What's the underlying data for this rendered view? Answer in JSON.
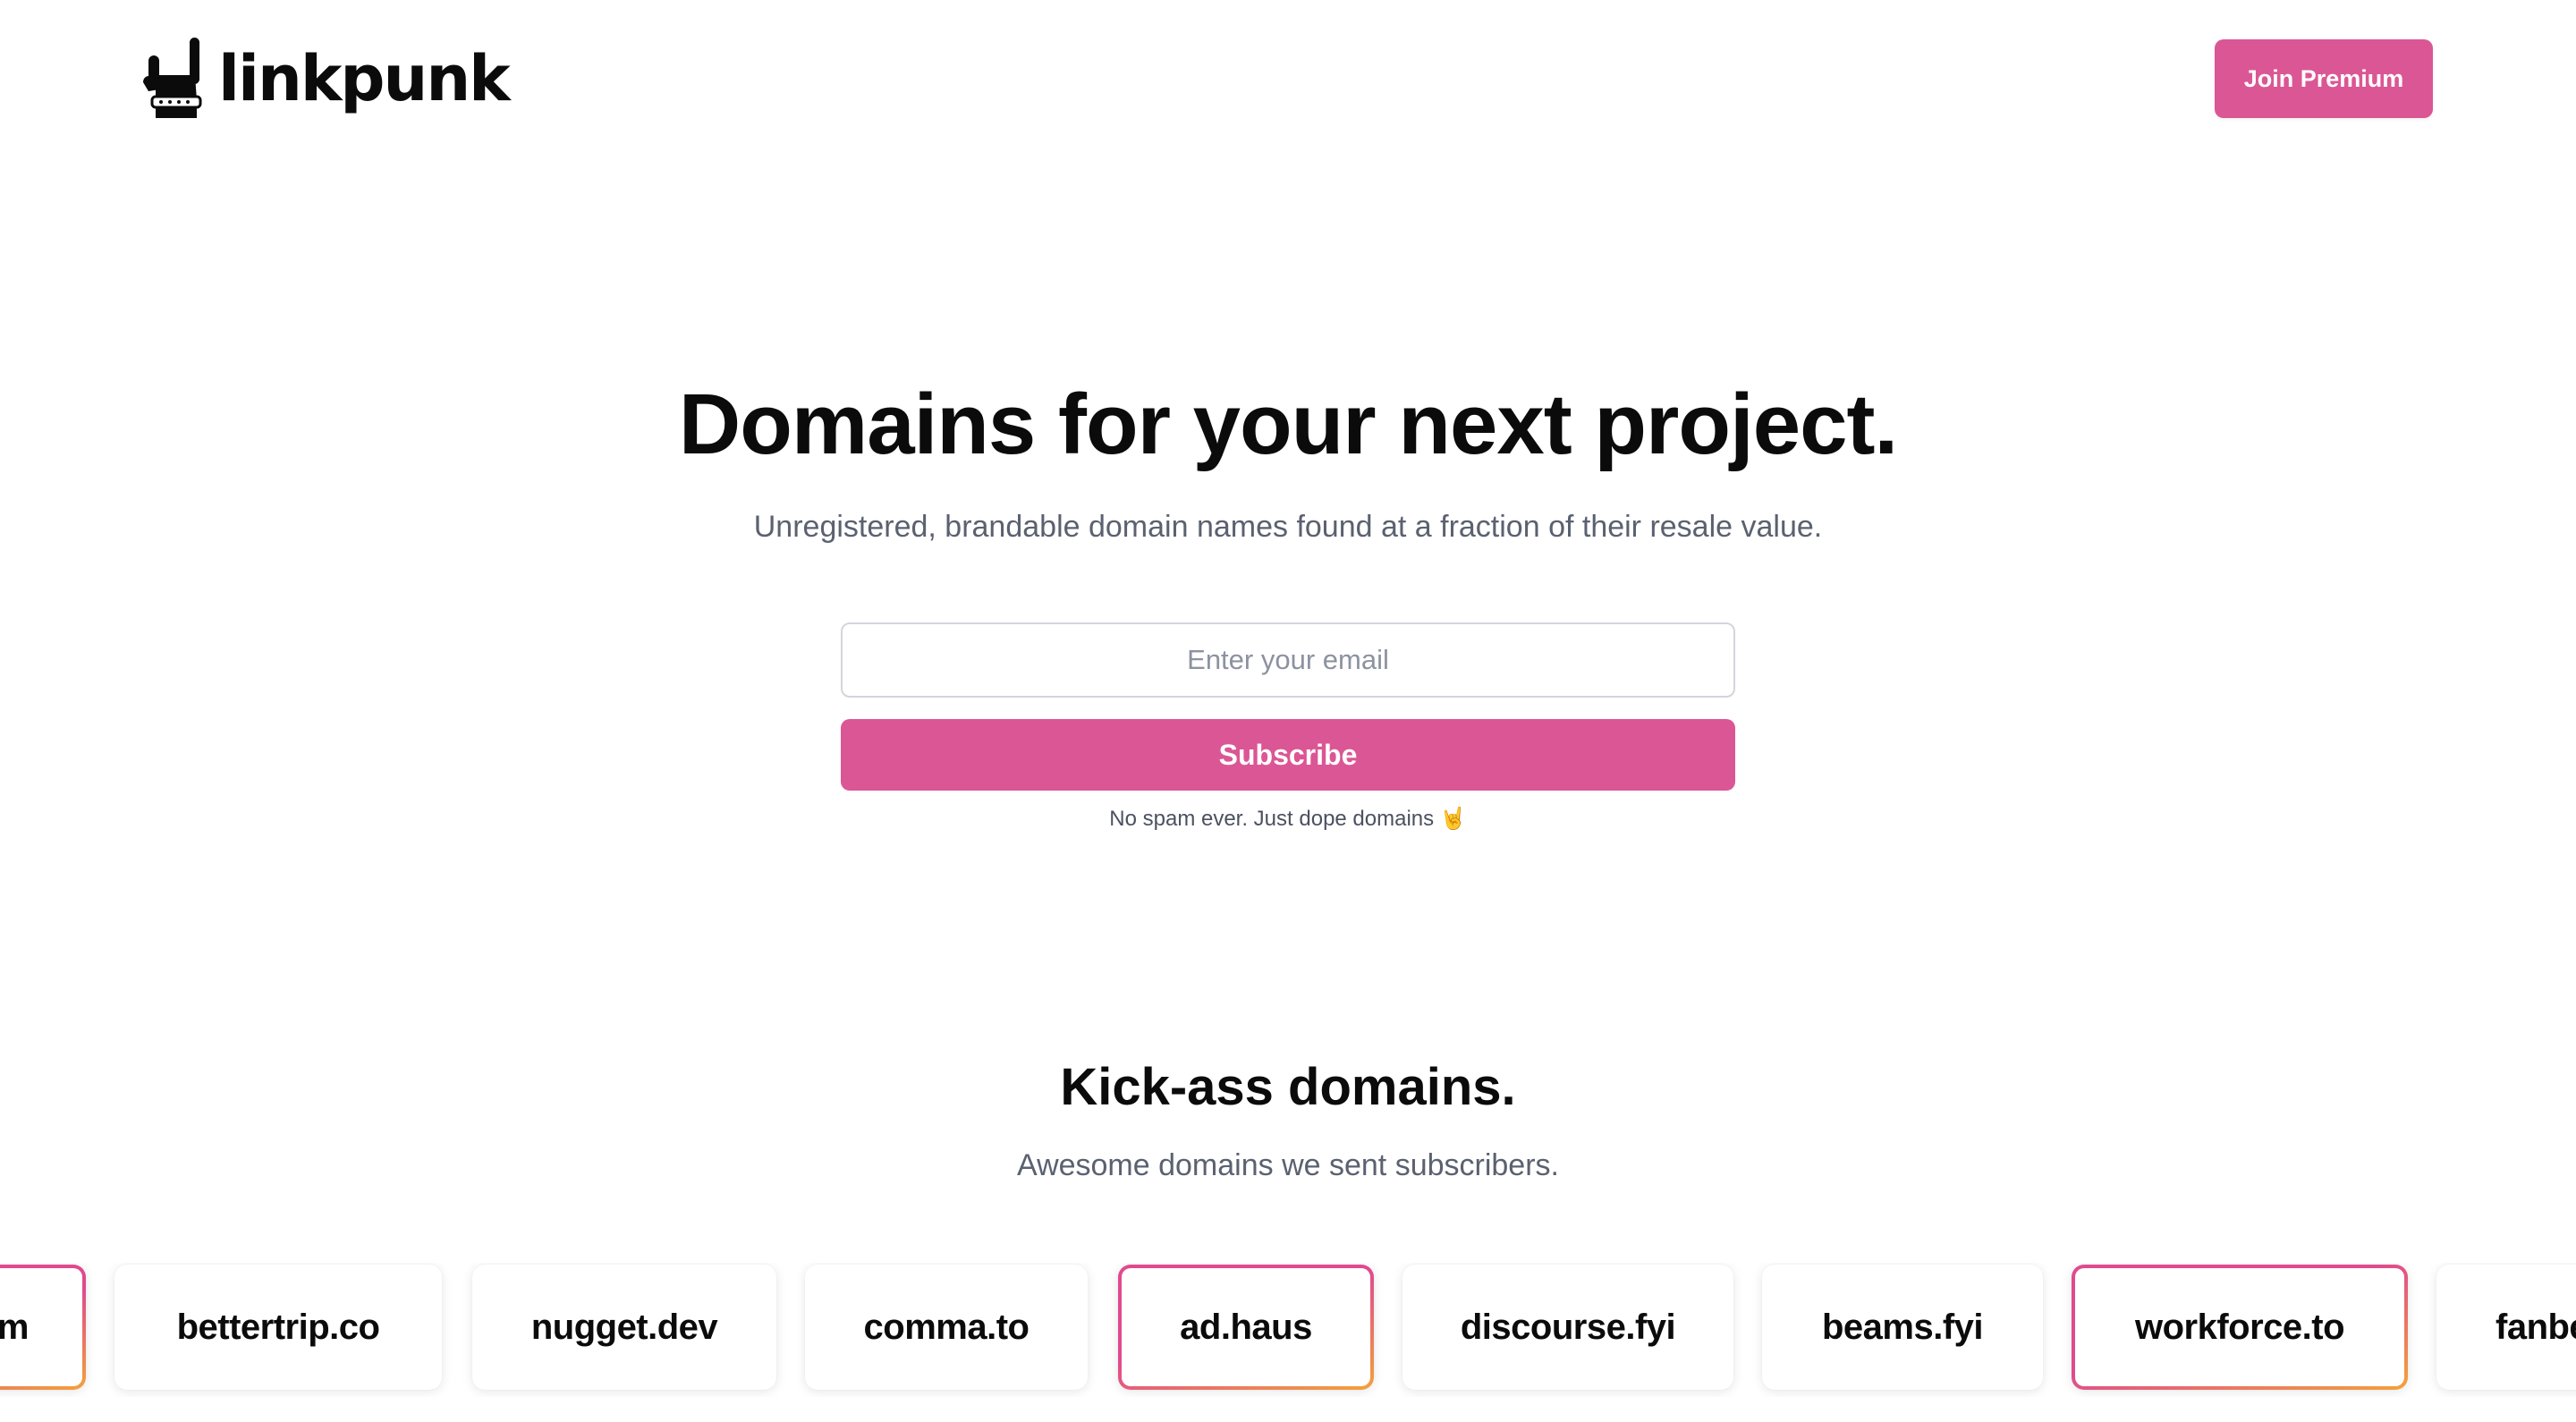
{
  "header": {
    "logo_text": "linkpunk",
    "join_label": "Join Premium"
  },
  "hero": {
    "title": "Domains for your next project.",
    "subtitle": "Unregistered, brandable domain names found at a fraction of their resale value.",
    "email_placeholder": "Enter your email",
    "subscribe_label": "Subscribe",
    "note": "No spam ever. Just dope domains 🤘"
  },
  "section": {
    "title": "Kick-ass domains.",
    "subtitle": "Awesome domains we sent subscribers."
  },
  "domains": [
    {
      "label": "m",
      "featured": true
    },
    {
      "label": "bettertrip.co",
      "featured": false
    },
    {
      "label": "nugget.dev",
      "featured": false
    },
    {
      "label": "comma.to",
      "featured": false
    },
    {
      "label": "ad.haus",
      "featured": true
    },
    {
      "label": "discourse.fyi",
      "featured": false
    },
    {
      "label": "beams.fyi",
      "featured": false
    },
    {
      "label": "workforce.to",
      "featured": true
    },
    {
      "label": "fanbe",
      "featured": false
    }
  ],
  "colors": {
    "brand_pink": "#db5695",
    "gradient_start": "#e04a8e",
    "gradient_end": "#f3a23a",
    "muted_text": "#5a6170"
  }
}
